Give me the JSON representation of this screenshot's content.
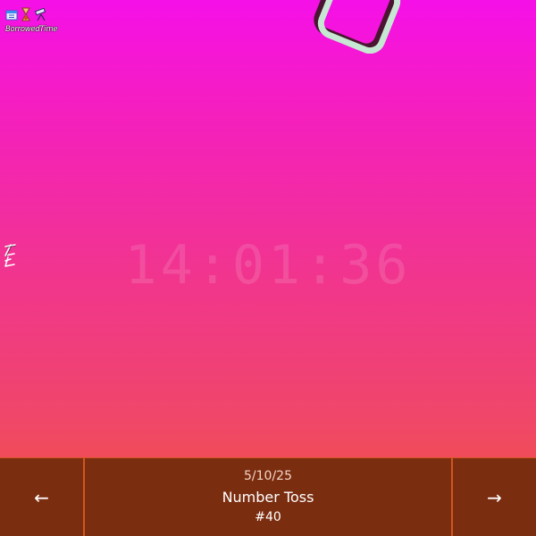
{
  "logo": {
    "text": "BorrowedTime",
    "icons": [
      "calendar-icon",
      "hourglass-icon",
      "telescope-icon"
    ]
  },
  "clock": {
    "time": "14:01:36"
  },
  "footer": {
    "prev_label": "←",
    "next_label": "→",
    "date": "5/10/25",
    "name": "Number Toss",
    "number": "#40"
  },
  "colors": {
    "gradient_top": "#f510e8",
    "gradient_bottom": "#ef5432",
    "footer_bg": "#7b2d10",
    "footer_divider": "#d0561f",
    "shape_outline": "#c6e8d2",
    "shape_shadow": "#4a1530"
  }
}
